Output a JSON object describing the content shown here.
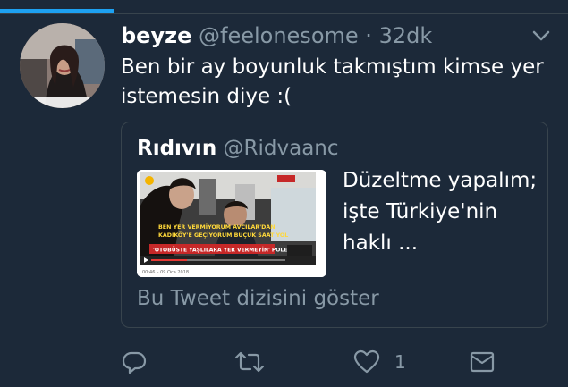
{
  "tweet": {
    "name": "beyze",
    "handle": "@feelonesome",
    "separator": "·",
    "time": "32dk",
    "text": "Ben bir ay boyunluk takmıştım kimse yer istemesin diye :("
  },
  "quote": {
    "name": "Rıdıvın",
    "handle": "@Ridvaanc",
    "text": "Düzeltme yapalım; işte Türkiye'nin haklı ...",
    "show_thread": "Bu Tweet dizisini göster",
    "media": {
      "caption_line1": "BEN YER VERMİYORUM AVCILAR'DAN",
      "caption_line2": "KADIKÖY'E GEÇİYORUM BUÇUK SAAT YOL",
      "headline": "'OTOBÜSTE YAŞLILARA YER VERMEYİN' POLEMİĞİ",
      "timestamp": "00:46 – 09 Oca 2018"
    }
  },
  "actions": {
    "like_count": "1"
  },
  "colors": {
    "background": "#1c2939",
    "accent": "#1da1f2",
    "secondary_text": "#8899a6",
    "border": "#38444d"
  },
  "icons": [
    "chevron-down-icon",
    "reply-icon",
    "retweet-icon",
    "like-icon",
    "direct-message-icon"
  ]
}
